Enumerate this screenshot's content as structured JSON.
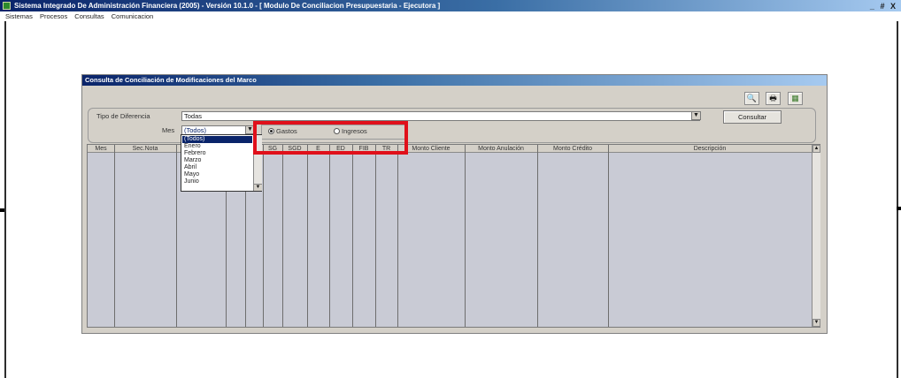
{
  "window": {
    "title": "Sistema Integrado De Administración Financiera (2005) - Versión 10.1.0 - [ Modulo De Conciliacion Presupuestaria - Ejecutora ]",
    "controls": [
      "_",
      "#",
      "X"
    ]
  },
  "menu": [
    "Sistemas",
    "Procesos",
    "Consultas",
    "Comunicacion"
  ],
  "dialog": {
    "title": "Consulta de Conciliación de Modificaciones del Marco",
    "toolbar_icons": [
      "search-icon",
      "print-icon",
      "export-icon"
    ]
  },
  "filters": {
    "tipo_label": "Tipo de Diferencia",
    "tipo_value": "Todas",
    "mes_label": "Mes",
    "mes_value": "(Todos)",
    "consultar_label": "Consultar",
    "radio_gastos": "Gastos",
    "radio_ingresos": "Ingresos",
    "selected_radio": "Gastos"
  },
  "grid": {
    "columns": [
      "Mes",
      "Sec.Nota",
      "",
      "",
      "",
      "SG",
      "SGD",
      "E",
      "ED",
      "FIB",
      "TR",
      "Monto Cliente",
      "Monto Anulación",
      "Monto Crédito",
      "Descripción"
    ]
  },
  "mes_dropdown": {
    "options": [
      "(Todos)",
      "Enero",
      "Febrero",
      "Marzo",
      "Abril",
      "Mayo",
      "Junio"
    ],
    "selected": "(Todos)"
  },
  "colors": {
    "title_bar": "#0a246a",
    "dialog_bg": "#d4d0c8",
    "grid_bg": "#c9cbd5",
    "highlight": "#e0101a"
  }
}
